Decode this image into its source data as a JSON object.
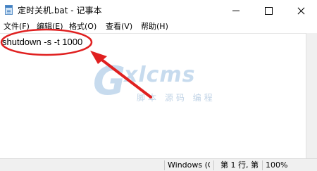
{
  "window": {
    "title": "定时关机.bat - 记事本"
  },
  "menu": {
    "items": [
      "文件(F)",
      "编辑(E)",
      "格式(O)",
      "查看(V)",
      "帮助(H)"
    ]
  },
  "editor": {
    "content": "shutdown -s -t 1000"
  },
  "watermark": {
    "letter": "G",
    "word": "xlcms",
    "subtitle": "脚本 源码 编程"
  },
  "statusbar": {
    "encoding": "Windows (C",
    "position": "第 1 行, 第",
    "zoom": "100%"
  },
  "annotation": {
    "color": "#e02020"
  }
}
